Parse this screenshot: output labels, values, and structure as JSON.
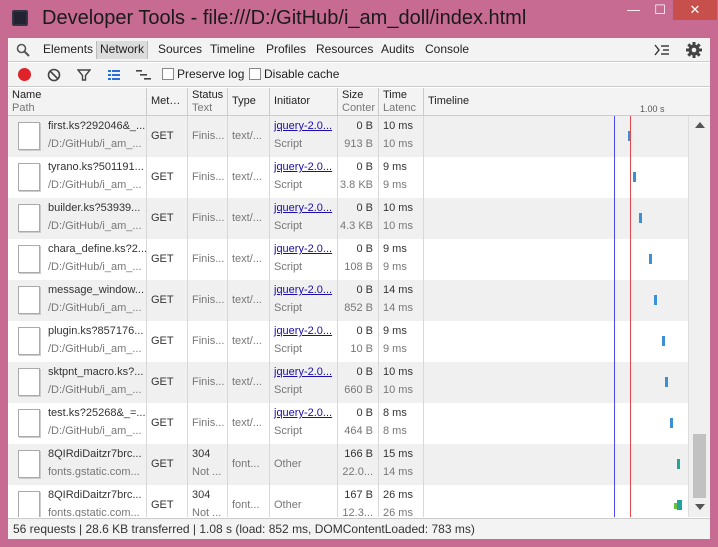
{
  "window": {
    "title": "Developer Tools - file:///D:/GitHub/i_am_doll/index.html",
    "min": "—",
    "max": "☐",
    "close": "✕"
  },
  "tabs": [
    "Elements",
    "Network",
    "Sources",
    "Timeline",
    "Profiles",
    "Resources",
    "Audits",
    "Console"
  ],
  "active_tab": "Network",
  "toolbar": {
    "preserve_log": "Preserve log",
    "disable_cache": "Disable cache"
  },
  "columns": {
    "name": "Name",
    "path": "Path",
    "method": "Met…",
    "status": "Status",
    "status_text": "Text",
    "type": "Type",
    "initiator": "Initiator",
    "size": "Size",
    "content": "Conter",
    "time": "Time",
    "latency": "Latenc",
    "timeline": "Timeline",
    "tick": "1.00 s"
  },
  "rows": [
    {
      "name": "first.ks?292046&_...",
      "path": "/D:/GitHub/i_am_...",
      "method": "GET",
      "status": "Finis...",
      "status_text": "",
      "type": "text/...",
      "initiator": "jquery-2.0...",
      "initiator_sub": "Script",
      "size": "0 B",
      "content": "913 B",
      "time": "10 ms",
      "latency": "10 ms",
      "bar_pos": 0.04,
      "bar_color": "#3b8fd6"
    },
    {
      "name": "tyrano.ks?501191...",
      "path": "/D:/GitHub/i_am_...",
      "method": "GET",
      "status": "Finis...",
      "status_text": "",
      "type": "text/...",
      "initiator": "jquery-2.0...",
      "initiator_sub": "Script",
      "size": "0 B",
      "content": "3.8 KB",
      "time": "9 ms",
      "latency": "9 ms",
      "bar_pos": 0.09,
      "bar_color": "#3b8fd6"
    },
    {
      "name": "builder.ks?53939...",
      "path": "/D:/GitHub/i_am_...",
      "method": "GET",
      "status": "Finis...",
      "status_text": "",
      "type": "text/...",
      "initiator": "jquery-2.0...",
      "initiator_sub": "Script",
      "size": "0 B",
      "content": "4.3 KB",
      "time": "10 ms",
      "latency": "10 ms",
      "bar_pos": 0.15,
      "bar_color": "#3b8fd6"
    },
    {
      "name": "chara_define.ks?2...",
      "path": "/D:/GitHub/i_am_...",
      "method": "GET",
      "status": "Finis...",
      "status_text": "",
      "type": "text/...",
      "initiator": "jquery-2.0...",
      "initiator_sub": "Script",
      "size": "0 B",
      "content": "108 B",
      "time": "9 ms",
      "latency": "9 ms",
      "bar_pos": 0.25,
      "bar_color": "#3b8fd6"
    },
    {
      "name": "message_window...",
      "path": "/D:/GitHub/i_am_...",
      "method": "GET",
      "status": "Finis...",
      "status_text": "",
      "type": "text/...",
      "initiator": "jquery-2.0...",
      "initiator_sub": "Script",
      "size": "0 B",
      "content": "852 B",
      "time": "14 ms",
      "latency": "14 ms",
      "bar_pos": 0.3,
      "bar_color": "#3b8fd6"
    },
    {
      "name": "plugin.ks?857176...",
      "path": "/D:/GitHub/i_am_...",
      "method": "GET",
      "status": "Finis...",
      "status_text": "",
      "type": "text/...",
      "initiator": "jquery-2.0...",
      "initiator_sub": "Script",
      "size": "0 B",
      "content": "10 B",
      "time": "9 ms",
      "latency": "9 ms",
      "bar_pos": 0.38,
      "bar_color": "#3b8fd6"
    },
    {
      "name": "sktpnt_macro.ks?...",
      "path": "/D:/GitHub/i_am_...",
      "method": "GET",
      "status": "Finis...",
      "status_text": "",
      "type": "text/...",
      "initiator": "jquery-2.0...",
      "initiator_sub": "Script",
      "size": "0 B",
      "content": "660 B",
      "time": "10 ms",
      "latency": "10 ms",
      "bar_pos": 0.41,
      "bar_color": "#3b8fd6"
    },
    {
      "name": "test.ks?25268&_=...",
      "path": "/D:/GitHub/i_am_...",
      "method": "GET",
      "status": "Finis...",
      "status_text": "",
      "type": "text/...",
      "initiator": "jquery-2.0...",
      "initiator_sub": "Script",
      "size": "0 B",
      "content": "464 B",
      "time": "8 ms",
      "latency": "8 ms",
      "bar_pos": 0.46,
      "bar_color": "#3b8fd6"
    },
    {
      "name": "8QIRdiDaitzr7brc...",
      "path": "fonts.gstatic.com...",
      "method": "GET",
      "status": "304",
      "status_text": "Not ...",
      "type": "font...",
      "initiator": "Other",
      "initiator_sub": "",
      "size": "166 B",
      "content": "22.0...",
      "time": "15 ms",
      "latency": "14 ms",
      "bar_pos": 0.53,
      "bar_color": "#1fa59a"
    },
    {
      "name": "8QIRdiDaitzr7brc...",
      "path": "fonts.gstatic.com...",
      "method": "GET",
      "status": "304",
      "status_text": "Not ...",
      "type": "font...",
      "initiator": "Other",
      "initiator_sub": "",
      "size": "167 B",
      "content": "12.3...",
      "time": "26 ms",
      "latency": "26 ms",
      "bar_pos": 0.53,
      "bar_color": "#1fa59a"
    }
  ],
  "status_bar": "56 requests  |  28.6 KB transferred  |  1.08 s (load: 852 ms, DOMContentLoaded: 783 ms)",
  "colors": {
    "record": "#e0232b",
    "dom_content_loaded_line": "#4a4af0",
    "load_line": "#e04a4a",
    "request_bar": "#3b8fd6",
    "font_bar": "#1fa59a"
  }
}
